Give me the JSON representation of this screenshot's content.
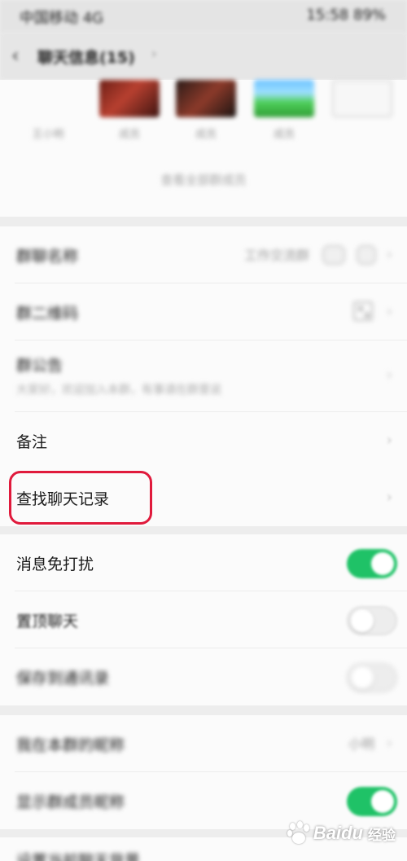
{
  "status_bar": {
    "left_text": "中国移动 4G",
    "right_text": "15:58 89%"
  },
  "nav": {
    "back_icon": "back-arrow-icon",
    "title": "聊天信息(15)",
    "title_icon": "chevron-right-icon"
  },
  "members": {
    "first_label": "王小明",
    "items": [
      {
        "name": "成员"
      },
      {
        "name": "成员"
      },
      {
        "name": "成员"
      }
    ],
    "add_label": "",
    "more_label": "查看全部群成员"
  },
  "group1": {
    "rows": [
      {
        "label": "群聊名称",
        "value": "工作交流群"
      },
      {
        "label": "群二维码",
        "value": ""
      },
      {
        "label": "群公告",
        "sub": "大家好，欢迎加入本群，有事请在群里说"
      },
      {
        "label": "备注",
        "value": ""
      }
    ]
  },
  "group2": {
    "rows": [
      {
        "label": "查找聊天记录"
      }
    ]
  },
  "group3": {
    "rows": [
      {
        "label": "消息免打扰",
        "toggle": "on"
      },
      {
        "label": "置顶聊天",
        "toggle": "off"
      },
      {
        "label": "保存到通讯录",
        "toggle": "off"
      }
    ]
  },
  "group4": {
    "rows": [
      {
        "label": "我在本群的昵称",
        "value": "小明"
      },
      {
        "label": "显示群成员昵称",
        "toggle": "on"
      }
    ]
  },
  "group5": {
    "rows": [
      {
        "label": "设置当前聊天背景"
      }
    ]
  },
  "colors": {
    "accent_green": "#1fc267",
    "highlight_red": "#e01a3c",
    "background": "#ededed"
  },
  "watermark": {
    "brand": "Baidu",
    "suffix": "经验",
    "icon": "baidu-paw-icon"
  }
}
